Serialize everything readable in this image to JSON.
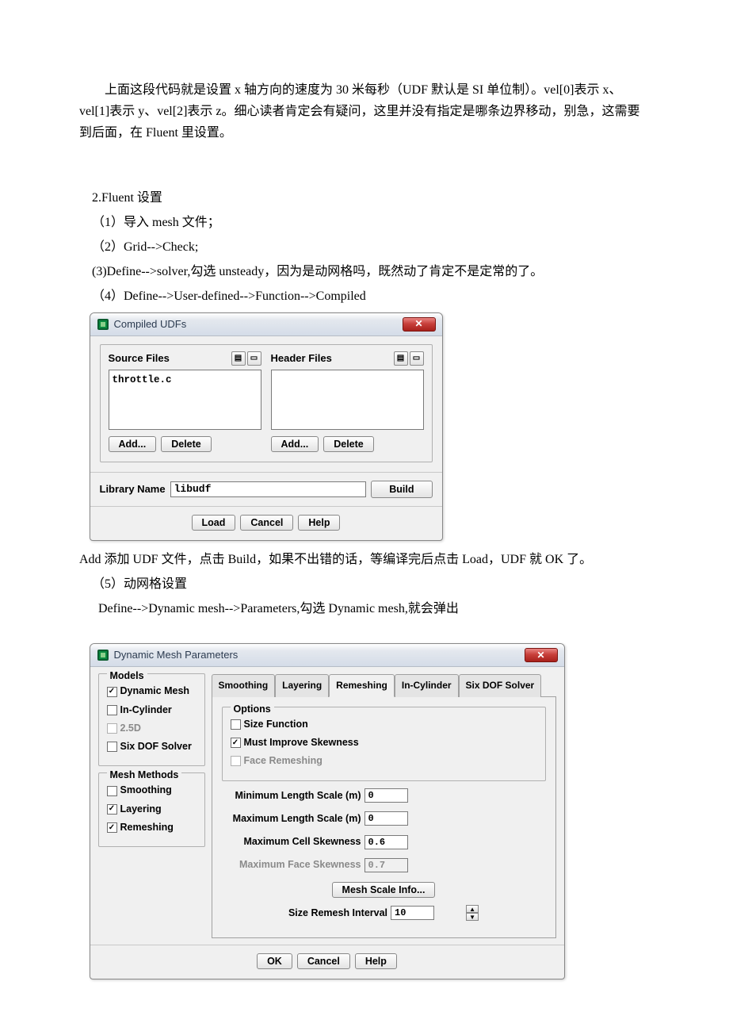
{
  "paragraphs": {
    "p1": "上面这段代码就是设置 x 轴方向的速度为 30 米每秒（UDF 默认是 SI 单位制）。vel[0]表示 x、vel[1]表示 y、vel[2]表示 z。细心读者肯定会有疑问，这里并没有指定是哪条边界移动，别急，这需要到后面，在 Fluent 里设置。",
    "s2": "2.Fluent 设置",
    "s2_1": "（1）导入 mesh 文件；",
    "s2_2": "（2）Grid-->Check;",
    "s2_3": "(3)Define-->solver,勾选 unsteady，因为是动网格吗，既然动了肯定不是定常的了。",
    "s2_4": "（4）Define-->User-defined-->Function-->Compiled",
    "after_udf": "Add 添加 UDF 文件，点击 Build，如果不出错的话，等编译完后点击 Load，UDF 就 OK 了。",
    "s2_5": "（5）动网格设置",
    "s2_5_line": "Define-->Dynamic mesh-->Parameters,勾选 Dynamic mesh,就会弹出"
  },
  "udf_dialog": {
    "title": "Compiled UDFs",
    "source_label": "Source Files",
    "header_label": "Header Files",
    "source_items": "throttle.c",
    "add": "Add...",
    "delete": "Delete",
    "libname_label": "Library Name",
    "libname_value": "libudf",
    "build": "Build",
    "load": "Load",
    "cancel": "Cancel",
    "help": "Help"
  },
  "dm_dialog": {
    "title": "Dynamic Mesh Parameters",
    "models": {
      "label": "Models",
      "dynamic_mesh": "Dynamic Mesh",
      "in_cylinder": "In-Cylinder",
      "twofive_d": "2.5D",
      "six_dof": "Six DOF Solver"
    },
    "mesh_methods": {
      "label": "Mesh Methods",
      "smoothing": "Smoothing",
      "layering": "Layering",
      "remeshing": "Remeshing"
    },
    "tabs": {
      "smoothing": "Smoothing",
      "layering": "Layering",
      "remeshing": "Remeshing",
      "in_cylinder": "In-Cylinder",
      "six_dof": "Six DOF Solver"
    },
    "options": {
      "label": "Options",
      "size_function": "Size Function",
      "must_improve": "Must Improve Skewness",
      "face_remeshing": "Face Remeshing"
    },
    "params": {
      "min_len_label": "Minimum Length Scale (m)",
      "min_len_value": "0",
      "max_len_label": "Maximum Length Scale (m)",
      "max_len_value": "0",
      "max_cell_skew_label": "Maximum Cell Skewness",
      "max_cell_skew_value": "0.6",
      "max_face_skew_label": "Maximum Face Skewness",
      "max_face_skew_value": "0.7",
      "mesh_scale_info": "Mesh Scale Info...",
      "size_remesh_label": "Size Remesh Interval",
      "size_remesh_value": "10"
    },
    "ok": "OK",
    "cancel": "Cancel",
    "help": "Help"
  }
}
